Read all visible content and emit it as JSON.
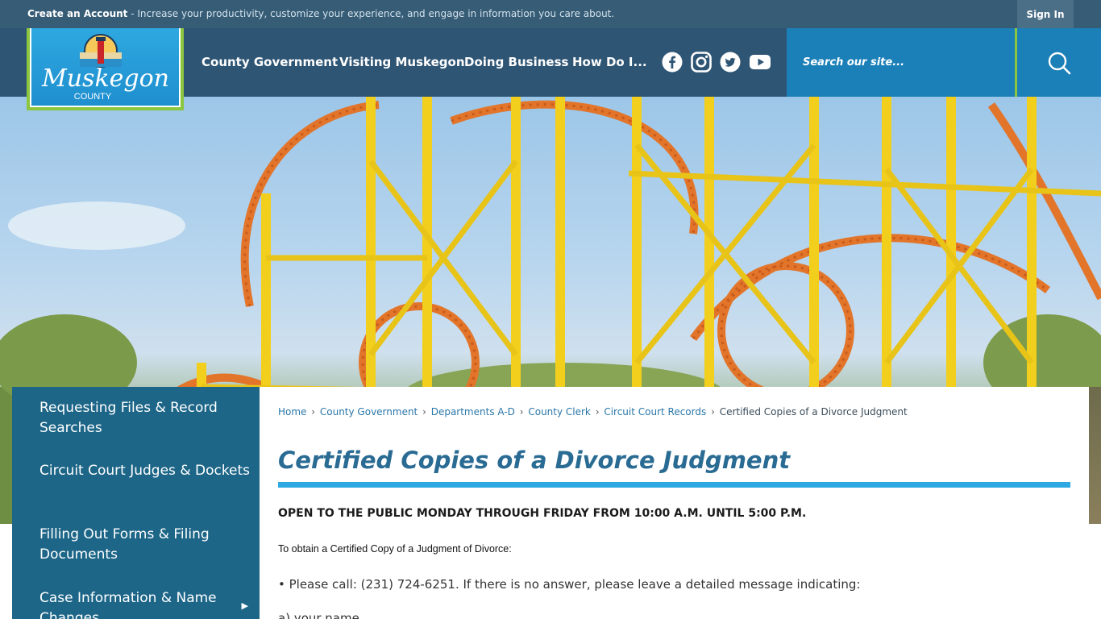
{
  "topbar": {
    "create_account": "Create an Account",
    "tagline": " - Increase your productivity, customize your experience, and engage in information you care about.",
    "sign_in": "Sign In"
  },
  "logo": {
    "line1": "Muskegon",
    "line2": "COUNTY"
  },
  "nav": {
    "items": [
      {
        "label": "County Government"
      },
      {
        "label": "Visiting Muskegon"
      },
      {
        "label": "Doing Business"
      },
      {
        "label": "How Do I..."
      }
    ]
  },
  "social": [
    "facebook-icon",
    "instagram-icon",
    "twitter-icon",
    "youtube-icon"
  ],
  "search": {
    "placeholder": "Search our site..."
  },
  "sidebar": {
    "items": [
      {
        "label": "Requesting Files & Record Searches"
      },
      {
        "label": "Circuit Court Judges & Dockets"
      },
      {
        "label": "Filling Out Forms & Filing Documents"
      },
      {
        "label": "Case Information & Name Changes"
      }
    ]
  },
  "breadcrumb": {
    "items": [
      "Home",
      "County Government",
      "Departments A-D",
      "County Clerk",
      "Circuit Court Records"
    ],
    "current": "Certified Copies of a Divorce Judgment"
  },
  "page": {
    "title": "Certified Copies of a Divorce Judgment",
    "hours": "OPEN TO THE PUBLIC MONDAY THROUGH FRIDAY FROM 10:00 A.M. UNTIL 5:00 P.M.",
    "obtain": "To obtain a Certified Copy of a Judgment of Divorce:",
    "call": "• Please call: (231) 724-6251. If there is no answer, please leave a detailed message indicating:",
    "item_a": "a) your name"
  },
  "colors": {
    "topbar": "#365c76",
    "header": "#2f5574",
    "search": "#1b80b8",
    "accent_green": "#8cc63f",
    "sidebar": "#1d6688",
    "title": "#2a6b94"
  }
}
